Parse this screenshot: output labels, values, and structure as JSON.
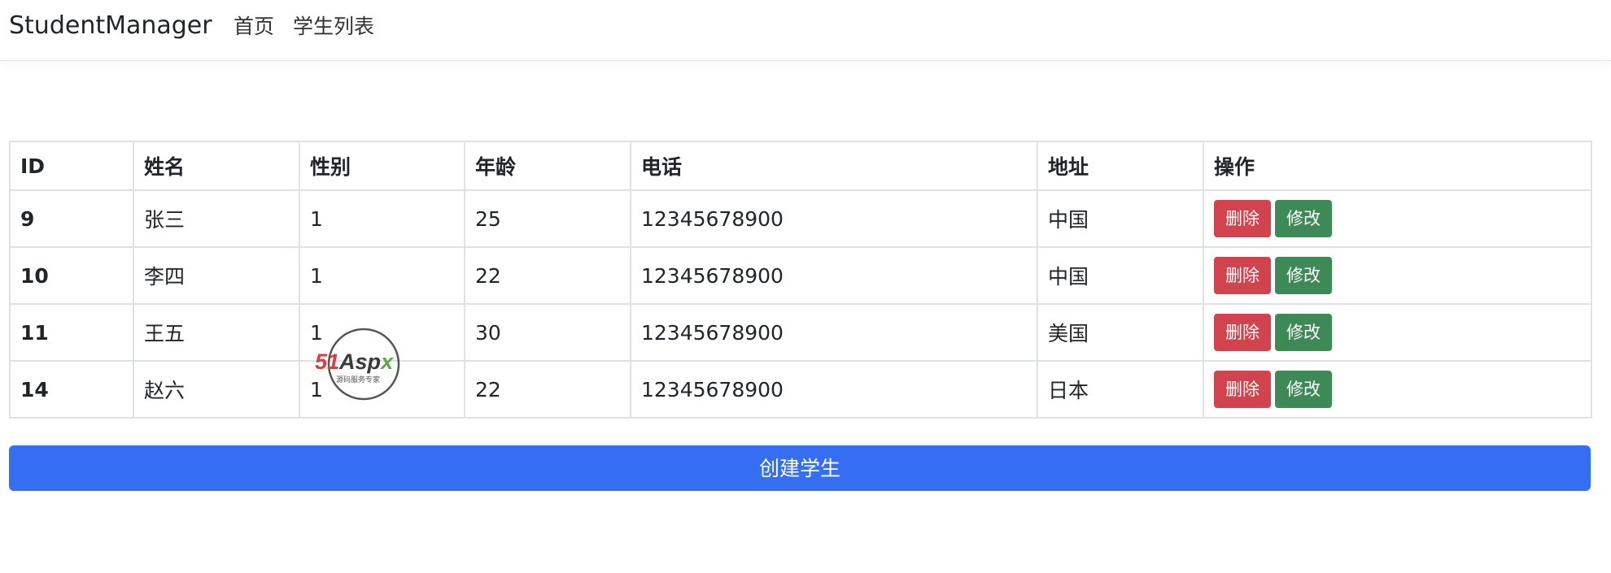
{
  "navbar": {
    "brand": "StudentManager",
    "links": [
      {
        "label": "首页"
      },
      {
        "label": "学生列表"
      }
    ]
  },
  "table": {
    "headers": [
      "ID",
      "姓名",
      "性别",
      "年龄",
      "电话",
      "地址",
      "操作"
    ],
    "rows": [
      {
        "id": "9",
        "name": "张三",
        "gender": "1",
        "age": "25",
        "phone": "12345678900",
        "address": "中国"
      },
      {
        "id": "10",
        "name": "李四",
        "gender": "1",
        "age": "22",
        "phone": "12345678900",
        "address": "中国"
      },
      {
        "id": "11",
        "name": "王五",
        "gender": "1",
        "age": "30",
        "phone": "12345678900",
        "address": "美国"
      },
      {
        "id": "14",
        "name": "赵六",
        "gender": "1",
        "age": "22",
        "phone": "12345678900",
        "address": "日本"
      }
    ],
    "delete_label": "删除",
    "edit_label": "修改"
  },
  "create_button": {
    "label": "创建学生"
  },
  "watermark": {
    "logo_text_red": "51",
    "logo_text_dark": "Asp",
    "logo_text_green": "x",
    "tagline": "源码服务专家"
  },
  "colors": {
    "primary": "#356ef3",
    "danger": "#d1444d",
    "success": "#3e8a57",
    "border": "#dee2e6"
  }
}
